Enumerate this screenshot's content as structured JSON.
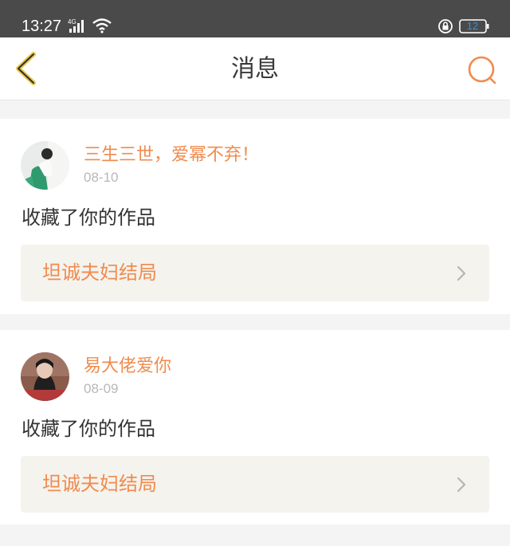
{
  "status_bar": {
    "time": "13:27",
    "network": "4G",
    "battery": "12"
  },
  "nav": {
    "title": "消息",
    "back_icon": "chevron-left-icon",
    "search_icon": "search-icon"
  },
  "messages": [
    {
      "username": "三生三世，爱幂不弃！",
      "date": "08-10",
      "action": "收藏了你的作品",
      "work_title": "坦诚夫妇结局"
    },
    {
      "username": "易大佬爱你",
      "date": "08-09",
      "action": "收藏了你的作品",
      "work_title": "坦诚夫妇结局"
    }
  ],
  "colors": {
    "accent": "#f08b4e",
    "back_icon": "#e8c84a",
    "status_bar": "#4a4a4a",
    "link_background": "#f4f3ee"
  }
}
